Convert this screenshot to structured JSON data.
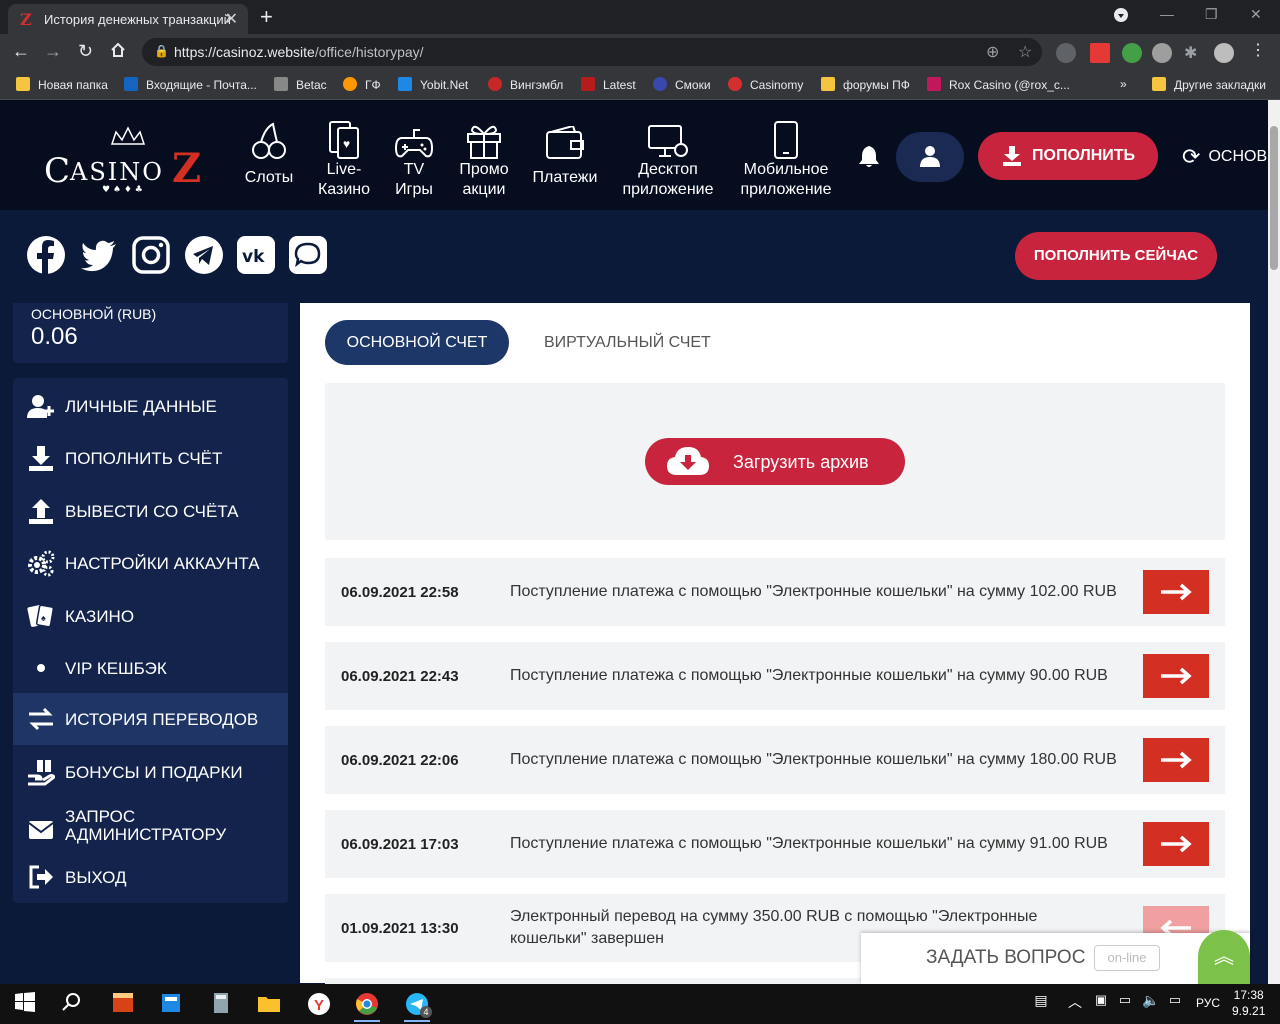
{
  "browser": {
    "tab_title": "История денежных транзакций",
    "url_host": "https://casinoz.website",
    "url_path": "/office/historypay/",
    "bookmarks": [
      {
        "label": "Новая папка",
        "color": "#f5c542"
      },
      {
        "label": "Входящие - Почта...",
        "color": "#1565c0"
      },
      {
        "label": "Betac",
        "color": "#888888"
      },
      {
        "label": "ГФ",
        "color": "#ff9800"
      },
      {
        "label": "Yobit.Net",
        "color": "#1e88e5"
      },
      {
        "label": "Вингэмбл",
        "color": "#c62828"
      },
      {
        "label": "Latest",
        "color": "#b71c1c"
      },
      {
        "label": "Смоки",
        "color": "#3949ab"
      },
      {
        "label": "Casinomy",
        "color": "#d32f2f"
      },
      {
        "label": "форумы ПФ",
        "color": "#f5c542"
      },
      {
        "label": "Rox Casino (@rox_c...",
        "color": "#c2185b"
      }
    ],
    "bookmarks_more": "»",
    "other_bookmarks": "Другие закладки"
  },
  "header": {
    "nav": [
      {
        "label": "Слоты",
        "icon": "cherries-icon"
      },
      {
        "label": "Live-\nКазино",
        "icon": "cards-icon"
      },
      {
        "label": "TV\nИгры",
        "icon": "gamepad-icon"
      },
      {
        "label": "Промо\nакции",
        "icon": "gift-icon"
      },
      {
        "label": "Платежи",
        "icon": "wallet-icon"
      },
      {
        "label": "Десктоп\nприложение",
        "icon": "desktop-icon"
      },
      {
        "label": "Мобильное\nприложение",
        "icon": "mobile-icon"
      }
    ],
    "deposit_label": "ПОПОЛНИТЬ",
    "balance_toggle_label": "ОСНОВ",
    "deposit_now_label": "ПОПОЛНИТЬ СЕЙЧАС"
  },
  "social": [
    "facebook-icon",
    "twitter-icon",
    "instagram-icon",
    "telegram-icon",
    "vk-icon",
    "chat-icon"
  ],
  "sidebar": {
    "balance_label": "ОСНОВНОЙ (RUB)",
    "balance_value": "0.06",
    "items": [
      {
        "label": "ЛИЧНЫЕ ДАННЫЕ",
        "icon": "user-plus-icon"
      },
      {
        "label": "ПОПОЛНИТЬ СЧЁТ",
        "icon": "download-icon"
      },
      {
        "label": "ВЫВЕСТИ СО СЧЁТА",
        "icon": "upload-icon"
      },
      {
        "label": "НАСТРОЙКИ АККАУНТА",
        "icon": "gears-icon"
      },
      {
        "label": "КАЗИНО",
        "icon": "cards-icon"
      },
      {
        "label": "VIP КЕШБЭК",
        "icon": "dot-icon"
      },
      {
        "label": "ИСТОРИЯ ПЕРЕВОДОВ",
        "icon": "exchange-icon"
      },
      {
        "label": "БОНУСЫ И ПОДАРКИ",
        "icon": "gift-hand-icon"
      },
      {
        "label": "ЗАПРОС\nАДМИНИСТРАТОРУ",
        "icon": "envelope-icon"
      },
      {
        "label": "ВЫХОД",
        "icon": "logout-icon"
      }
    ]
  },
  "content": {
    "tab_main": "ОСНОВНОЙ СЧЕТ",
    "tab_virtual": "ВИРТУАЛЬНЫЙ СЧЕТ",
    "archive_button": "Загрузить архив",
    "transactions": [
      {
        "date": "06.09.2021 22:58",
        "text": "Поступление платежа с помощью \"Электронные кошельки\" на сумму 102.00 RUB",
        "direction": "in"
      },
      {
        "date": "06.09.2021 22:43",
        "text": "Поступление платежа с помощью \"Электронные кошельки\" на сумму 90.00 RUB",
        "direction": "in"
      },
      {
        "date": "06.09.2021 22:06",
        "text": "Поступление платежа с помощью \"Электронные кошельки\" на сумму 180.00 RUB",
        "direction": "in"
      },
      {
        "date": "06.09.2021 17:03",
        "text": "Поступление платежа с помощью \"Электронные кошельки\" на сумму 91.00 RUB",
        "direction": "in"
      },
      {
        "date": "01.09.2021 13:30",
        "text": "Электронный перевод на сумму 350.00 RUB с помощью \"Электронные кошельки\" завершен",
        "direction": "out"
      }
    ]
  },
  "chat": {
    "label": "ЗАДАТЬ ВОПРОС",
    "status": "on-line"
  },
  "taskbar": {
    "lang": "РУС",
    "time": "17:38",
    "date": "9.9.21",
    "telegram_badge": "4"
  },
  "colors": {
    "accent_red": "#c8243e",
    "navy": "#0c1a3a",
    "arrow_red": "#d42f23"
  }
}
